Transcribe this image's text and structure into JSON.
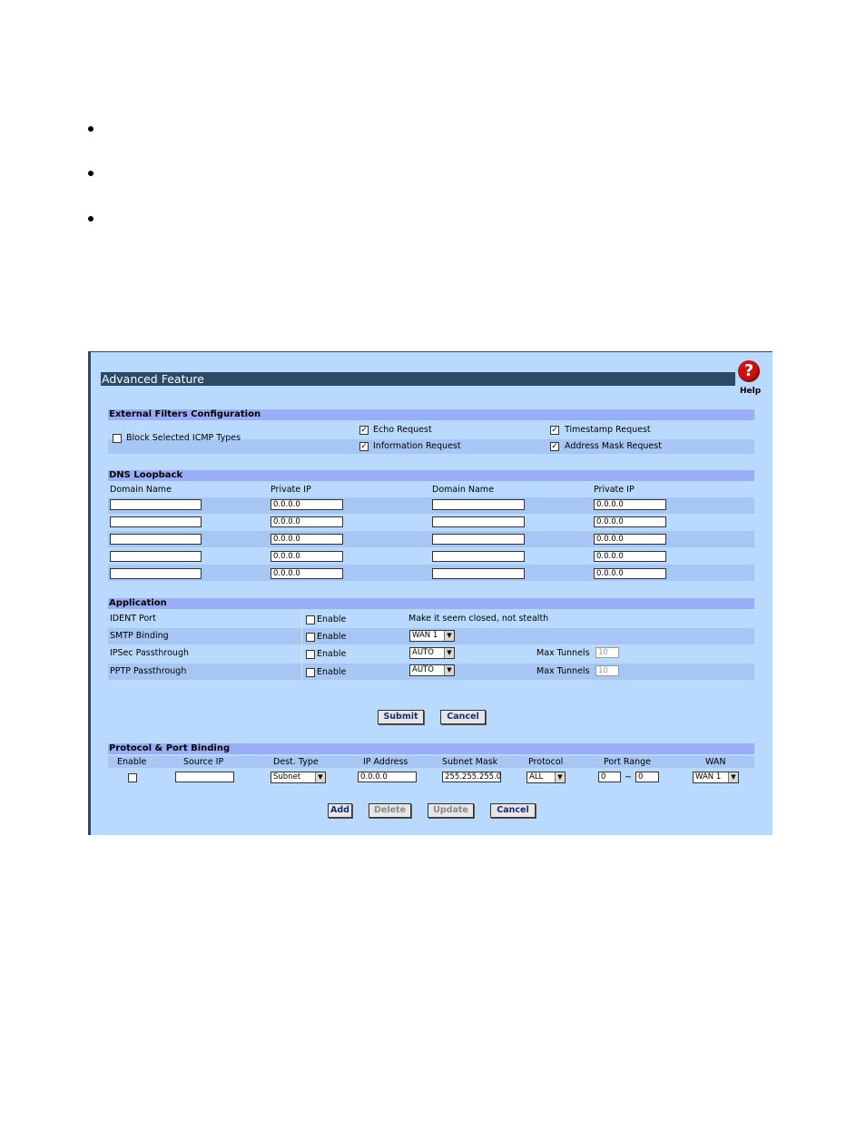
{
  "panel": {
    "title": "Advanced Feature",
    "help_label": "Help",
    "help_glyph": "?"
  },
  "external_filters": {
    "header": "External Filters Configuration",
    "block_icmp": {
      "label": "Block Selected ICMP Types",
      "checked": false
    },
    "options": [
      {
        "label": "Echo Request",
        "checked": true
      },
      {
        "label": "Timestamp Request",
        "checked": true
      },
      {
        "label": "Information Request",
        "checked": true
      },
      {
        "label": "Address Mask Request",
        "checked": true
      }
    ]
  },
  "dns_loopback": {
    "header": "DNS Loopback",
    "columns": [
      "Domain Name",
      "Private IP",
      "Domain Name",
      "Private IP"
    ],
    "rows": [
      {
        "domain1": "",
        "ip1": "0.0.0.0",
        "domain2": "",
        "ip2": "0.0.0.0"
      },
      {
        "domain1": "",
        "ip1": "0.0.0.0",
        "domain2": "",
        "ip2": "0.0.0.0"
      },
      {
        "domain1": "",
        "ip1": "0.0.0.0",
        "domain2": "",
        "ip2": "0.0.0.0"
      },
      {
        "domain1": "",
        "ip1": "0.0.0.0",
        "domain2": "",
        "ip2": "0.0.0.0"
      },
      {
        "domain1": "",
        "ip1": "0.0.0.0",
        "domain2": "",
        "ip2": "0.0.0.0"
      }
    ]
  },
  "application": {
    "header": "Application",
    "enable_label": "Enable",
    "ident": {
      "label": "IDENT Port",
      "note": "Make it seem closed, not stealth"
    },
    "smtp": {
      "label": "SMTP Binding",
      "wan": "WAN 1"
    },
    "ipsec": {
      "label": "IPSec Passthrough",
      "mode": "AUTO",
      "max_label": "Max Tunnels",
      "max_value": "10"
    },
    "pptp": {
      "label": "PPTP Passthrough",
      "mode": "AUTO",
      "max_label": "Max Tunnels",
      "max_value": "10"
    }
  },
  "form_buttons": {
    "submit": "Submit",
    "cancel": "Cancel"
  },
  "binding": {
    "header": "Protocol & Port Binding",
    "columns": [
      "Enable",
      "Source IP",
      "Dest. Type",
      "IP Address",
      "Subnet Mask",
      "Protocol",
      "Port Range",
      "WAN"
    ],
    "row": {
      "source_ip": "",
      "dest_type": "Subnet",
      "ip_address": "0.0.0.0",
      "subnet_mask": "255.255.255.0",
      "protocol": "ALL",
      "port_from": "0",
      "range_sep": "~",
      "port_to": "0",
      "wan": "WAN 1"
    },
    "buttons": {
      "add": "Add",
      "delete": "Delete",
      "update": "Update",
      "cancel": "Cancel"
    }
  }
}
